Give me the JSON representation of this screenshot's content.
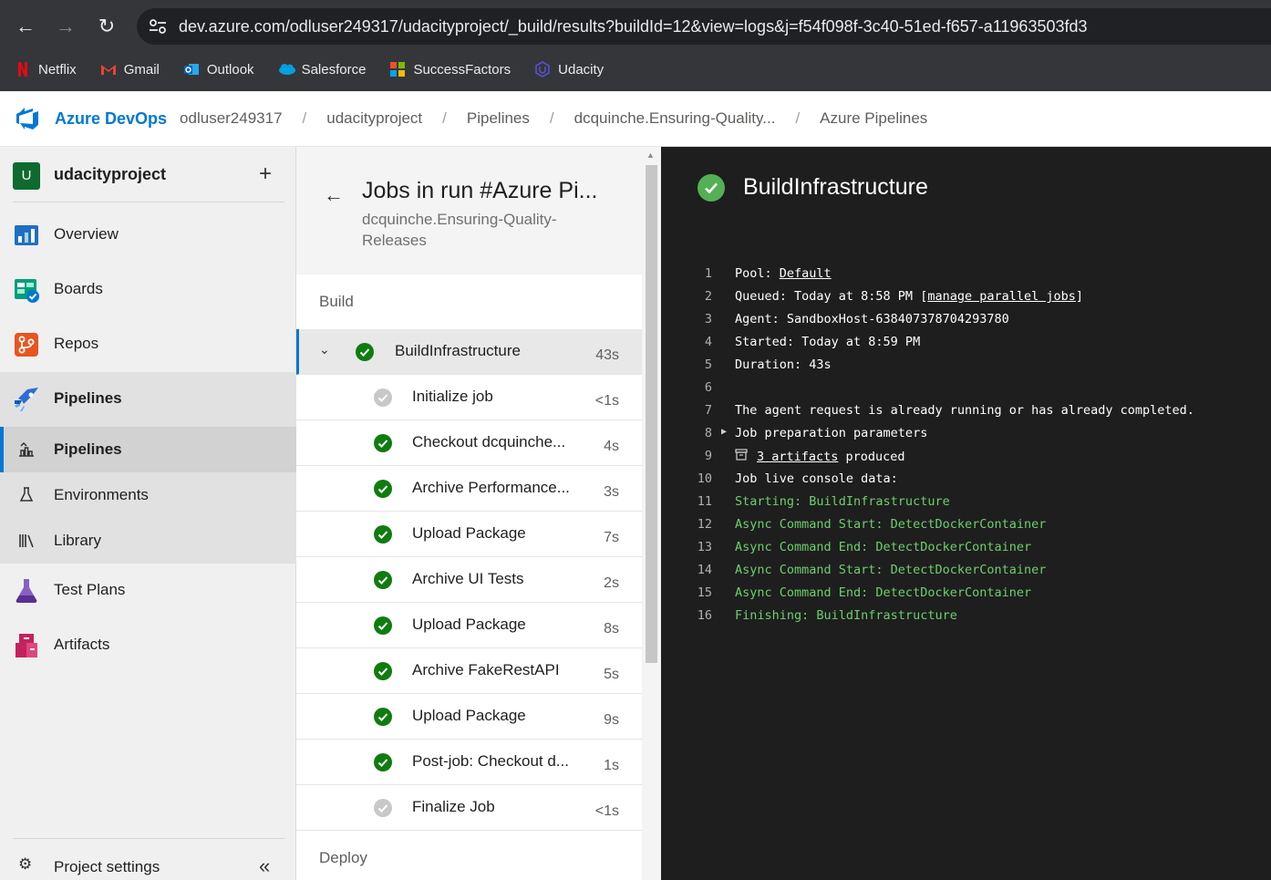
{
  "browser": {
    "url": "dev.azure.com/odluser249317/udacityproject/_build/results?buildId=12&view=logs&j=f54f098f-3c40-51ed-f657-a11963503fd3",
    "bookmarks": [
      {
        "label": "Netflix",
        "icon": "netflix-icon"
      },
      {
        "label": "Gmail",
        "icon": "gmail-icon"
      },
      {
        "label": "Outlook",
        "icon": "outlook-icon"
      },
      {
        "label": "Salesforce",
        "icon": "salesforce-icon"
      },
      {
        "label": "SuccessFactors",
        "icon": "successfactors-icon"
      },
      {
        "label": "Udacity",
        "icon": "udacity-icon"
      }
    ]
  },
  "header": {
    "brand": "Azure DevOps",
    "breadcrumbs": [
      "odluser249317",
      "udacityproject",
      "Pipelines",
      "dcquinche.Ensuring-Quality...",
      "Azure Pipelines"
    ],
    "separator": "/"
  },
  "sidebar": {
    "project_initial": "U",
    "project_name": "udacityproject",
    "add_label": "+",
    "items": [
      {
        "label": "Overview",
        "icon": "overview-icon"
      },
      {
        "label": "Boards",
        "icon": "boards-icon"
      },
      {
        "label": "Repos",
        "icon": "repos-icon"
      },
      {
        "label": "Pipelines",
        "icon": "pipelines-icon"
      },
      {
        "label": "Test Plans",
        "icon": "test-plans-icon"
      },
      {
        "label": "Artifacts",
        "icon": "artifacts-icon"
      }
    ],
    "sub_items": [
      {
        "label": "Pipelines",
        "icon": "pipelines-sub-icon"
      },
      {
        "label": "Environments",
        "icon": "environments-icon"
      },
      {
        "label": "Library",
        "icon": "library-icon"
      }
    ],
    "settings_label": "Project settings",
    "collapse_label": "«"
  },
  "jobs": {
    "title": "Jobs in run #Azure Pi...",
    "subtitle": "dcquinche.Ensuring-Quality-Releases",
    "stage_build": "Build",
    "stage_deploy": "Deploy",
    "main_job": {
      "name": "BuildInfrastructure",
      "duration": "43s",
      "status": "succeeded"
    },
    "steps": [
      {
        "name": "Initialize job",
        "duration": "<1s",
        "status": "pending"
      },
      {
        "name": "Checkout dcquinche...",
        "duration": "4s",
        "status": "succeeded"
      },
      {
        "name": "Archive Performance...",
        "duration": "3s",
        "status": "succeeded"
      },
      {
        "name": "Upload Package",
        "duration": "7s",
        "status": "succeeded"
      },
      {
        "name": "Archive UI Tests",
        "duration": "2s",
        "status": "succeeded"
      },
      {
        "name": "Upload Package",
        "duration": "8s",
        "status": "succeeded"
      },
      {
        "name": "Archive FakeRestAPI",
        "duration": "5s",
        "status": "succeeded"
      },
      {
        "name": "Upload Package",
        "duration": "9s",
        "status": "succeeded"
      },
      {
        "name": "Post-job: Checkout d...",
        "duration": "1s",
        "status": "succeeded"
      },
      {
        "name": "Finalize Job",
        "duration": "<1s",
        "status": "pending"
      }
    ]
  },
  "log": {
    "title": "BuildInfrastructure",
    "lines": [
      {
        "n": "1",
        "text": "Pool: ",
        "link": "Default",
        "after": ""
      },
      {
        "n": "2",
        "text": "Queued: Today at 8:58 PM [",
        "link": "manage parallel jobs",
        "after": "]"
      },
      {
        "n": "3",
        "text": "Agent: SandboxHost-638407378704293780"
      },
      {
        "n": "4",
        "text": "Started: Today at 8:59 PM"
      },
      {
        "n": "5",
        "text": "Duration: 43s"
      },
      {
        "n": "6",
        "text": ""
      },
      {
        "n": "7",
        "text": "The agent request is already running or has already completed."
      },
      {
        "n": "8",
        "text": "Job preparation parameters",
        "expand": "▶"
      },
      {
        "n": "9",
        "text": "",
        "link": "3 artifacts",
        "after": " produced",
        "icon": "artifact-box-icon"
      },
      {
        "n": "10",
        "text": "Job live console data:"
      },
      {
        "n": "11",
        "text": "Starting: BuildInfrastructure",
        "green": true
      },
      {
        "n": "12",
        "text": "Async Command Start: DetectDockerContainer",
        "green": true
      },
      {
        "n": "13",
        "text": "Async Command End: DetectDockerContainer",
        "green": true
      },
      {
        "n": "14",
        "text": "Async Command Start: DetectDockerContainer",
        "green": true
      },
      {
        "n": "15",
        "text": "Async Command End: DetectDockerContainer",
        "green": true
      },
      {
        "n": "16",
        "text": "Finishing: BuildInfrastructure",
        "green": true
      }
    ]
  },
  "colors": {
    "accent": "#0078d4",
    "success": "#107c10",
    "log_bg": "#1e1e1e",
    "log_green": "#6ccf6c"
  }
}
